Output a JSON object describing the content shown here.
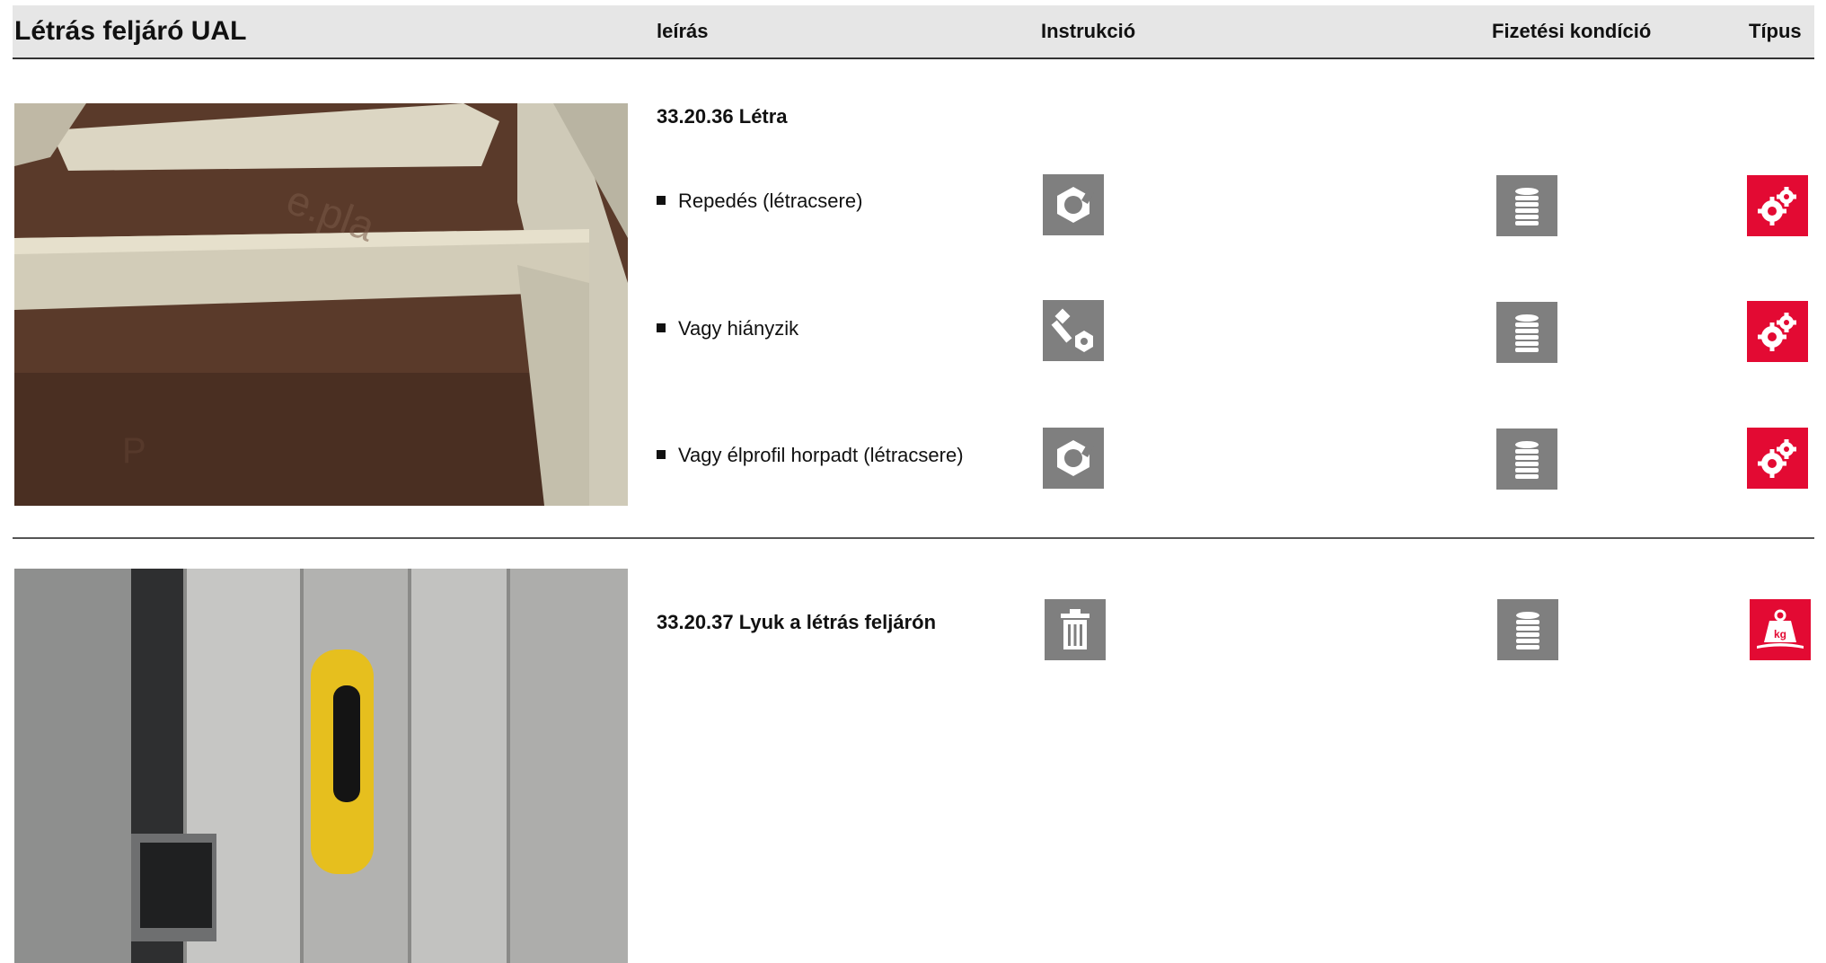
{
  "header": {
    "title": "Létrás feljáró UAL",
    "col_description": "leírás",
    "col_instruction": "Instrukció",
    "col_payment": "Fizetési kondíció",
    "col_type": "Típus"
  },
  "sections": [
    {
      "code": "33.20.36 Létra",
      "image": "ladder-photo",
      "items": [
        {
          "label": "Repedés (létracsere)",
          "instruction_icon": "nut-icon",
          "payment_icon": "coin-stack-icon",
          "type_icon": "gears-icon"
        },
        {
          "label": "Vagy hiányzik",
          "instruction_icon": "bolt-nut-icon",
          "payment_icon": "coin-stack-icon",
          "type_icon": "gears-icon"
        },
        {
          "label": "Vagy élprofil horpadt (létracsere)",
          "instruction_icon": "nut-icon",
          "payment_icon": "coin-stack-icon",
          "type_icon": "gears-icon"
        }
      ]
    },
    {
      "code": "33.20.37 Lyuk a létrás feljárón",
      "image": "hatch-photo",
      "instruction_icon": "trash-icon",
      "payment_icon": "coin-stack-icon",
      "type_icon": "weight-kg-icon",
      "weight_label": "kg"
    }
  ],
  "colors": {
    "header_bg": "#e6e6e6",
    "icon_gray": "#7f7f7f",
    "icon_red": "#e30a33"
  }
}
